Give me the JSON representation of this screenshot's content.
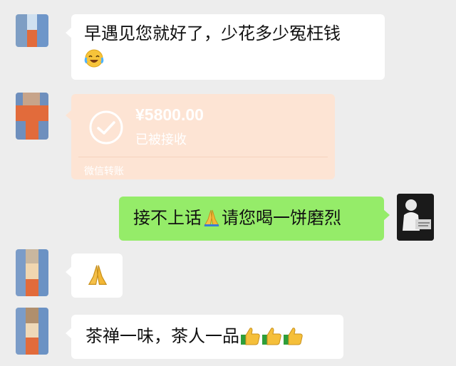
{
  "messages": {
    "m1": {
      "text_line1": "早遇见您就好了，少花多少冤枉钱"
    },
    "m2": {
      "amount": "¥5800.00",
      "status": "已被接收",
      "caption": "微信转账"
    },
    "m3": {
      "text_part1": "接不上话",
      "text_part2": "请您喝一饼磨烈"
    },
    "m5": {
      "text": "茶禅一味，茶人一品"
    }
  },
  "colors": {
    "background": "#ededed",
    "incoming_bubble": "#ffffff",
    "outgoing_bubble": "#95ec69",
    "transfer_card": "#fde4d4"
  },
  "icons": [
    "laughing-crying-emoji",
    "check-circle-icon",
    "praying-hands-emoji",
    "thumbs-up-emoji"
  ]
}
